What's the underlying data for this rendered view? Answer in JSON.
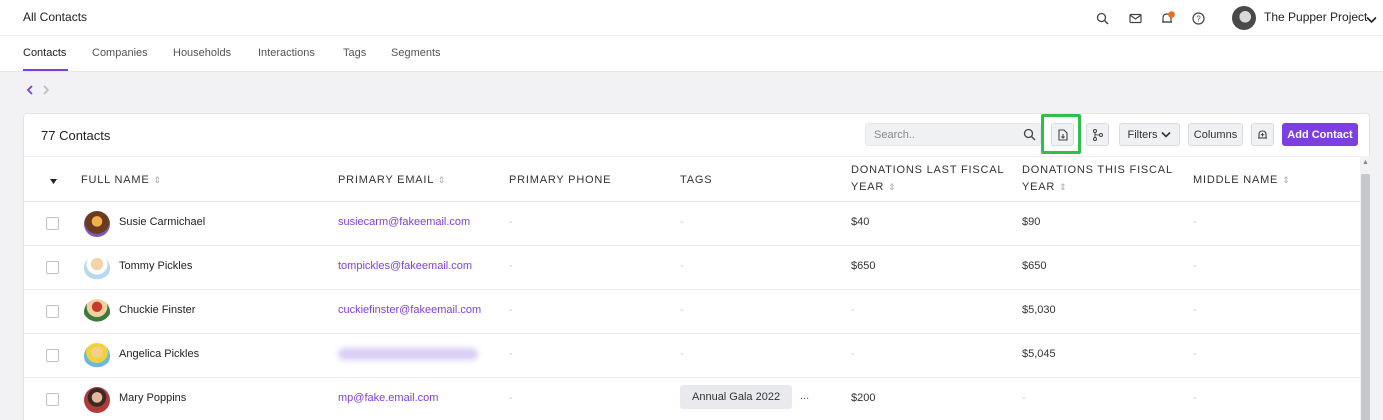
{
  "topbar": {
    "page_title": "All Contacts",
    "org_name": "The Pupper Project",
    "icons": [
      "search-icon",
      "mail-icon",
      "bell-icon",
      "help-icon",
      "chevron-down-icon"
    ],
    "notification_color": "#f26a1b"
  },
  "tabs": [
    "Contacts",
    "Companies",
    "Households",
    "Interactions",
    "Tags",
    "Segments"
  ],
  "card": {
    "count_label": "77 Contacts",
    "search_placeholder": "Search..",
    "filters_label": "Filters",
    "columns_label": "Columns",
    "add_label": "Add Contact"
  },
  "columns": {
    "full_name": "FULL NAME",
    "primary_email": "PRIMARY EMAIL",
    "primary_phone": "PRIMARY PHONE",
    "tags": "TAGS",
    "donations_last_1": "DONATIONS LAST FISCAL",
    "donations_last_2": "YEAR",
    "donations_this_1": "DONATIONS THIS FISCAL",
    "donations_this_2": "YEAR",
    "middle_name": "MIDDLE NAME",
    "sort_glyph": "⇕"
  },
  "rows": [
    {
      "name": "Susie Carmichael",
      "email": "susiecarm@fakeemail.com",
      "phone": "-",
      "tags": "-",
      "last": "$40",
      "this": "$90",
      "middle": "-"
    },
    {
      "name": "Tommy Pickles",
      "email": "tompickles@fakeemail.com",
      "phone": "-",
      "tags": "-",
      "last": "$650",
      "this": "$650",
      "middle": "-"
    },
    {
      "name": "Chuckie Finster",
      "email": "cuckiefinster@fakeemail.com",
      "phone": "-",
      "tags": "-",
      "last": "-",
      "this": "$5,030",
      "middle": "-"
    },
    {
      "name": "Angelica Pickles",
      "email": "",
      "phone": "-",
      "tags": "-",
      "last": "-",
      "this": "$5,045",
      "middle": "-"
    },
    {
      "name": "Mary Poppins",
      "email": "mp@fake.email.com",
      "phone": "-",
      "tags": "Annual Gala 2022",
      "tags_more": "...",
      "last": "$200",
      "this": "-",
      "middle": "-"
    }
  ],
  "colors": {
    "accent": "#7b3fe4",
    "highlight": "#2ec04a"
  }
}
